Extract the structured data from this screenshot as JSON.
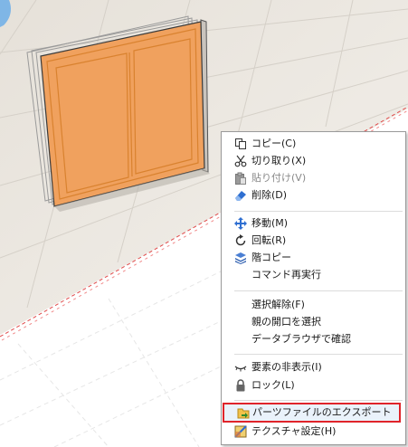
{
  "context_menu": {
    "items": [
      {
        "label": "コピー(C)",
        "icon": "copy-icon",
        "enabled": true
      },
      {
        "label": "切り取り(X)",
        "icon": "scissors-icon",
        "enabled": true
      },
      {
        "label": "貼り付け(V)",
        "icon": "paste-icon",
        "enabled": false
      },
      {
        "label": "削除(D)",
        "icon": "eraser-icon",
        "enabled": true
      },
      {
        "label": "移動(M)",
        "icon": "move-arrows-icon",
        "enabled": true
      },
      {
        "label": "回転(R)",
        "icon": "rotate-icon",
        "enabled": true
      },
      {
        "label": "階コピー",
        "icon": "floor-copy-icon",
        "enabled": true
      },
      {
        "label": "コマンド再実行",
        "icon": "",
        "enabled": true
      },
      {
        "label": "選択解除(F)",
        "icon": "",
        "enabled": true
      },
      {
        "label": "親の開口を選択",
        "icon": "",
        "enabled": true
      },
      {
        "label": "データブラウザで確認",
        "icon": "",
        "enabled": true
      },
      {
        "label": "要素の非表示(I)",
        "icon": "eye-closed-icon",
        "enabled": true
      },
      {
        "label": "ロック(L)",
        "icon": "lock-icon",
        "enabled": true
      },
      {
        "label": "パーツファイルのエクスポート",
        "icon": "parts-export-icon",
        "enabled": true,
        "highlighted": true
      },
      {
        "label": "テクスチャ設定(H)",
        "icon": "texture-icon",
        "enabled": true
      }
    ]
  },
  "colors": {
    "panel_orange": "#f0a15e",
    "frame_orange": "#e8913f",
    "floor": "#ece7df",
    "grid": "#d7d2ca",
    "highlight_border": "#e0242a"
  }
}
